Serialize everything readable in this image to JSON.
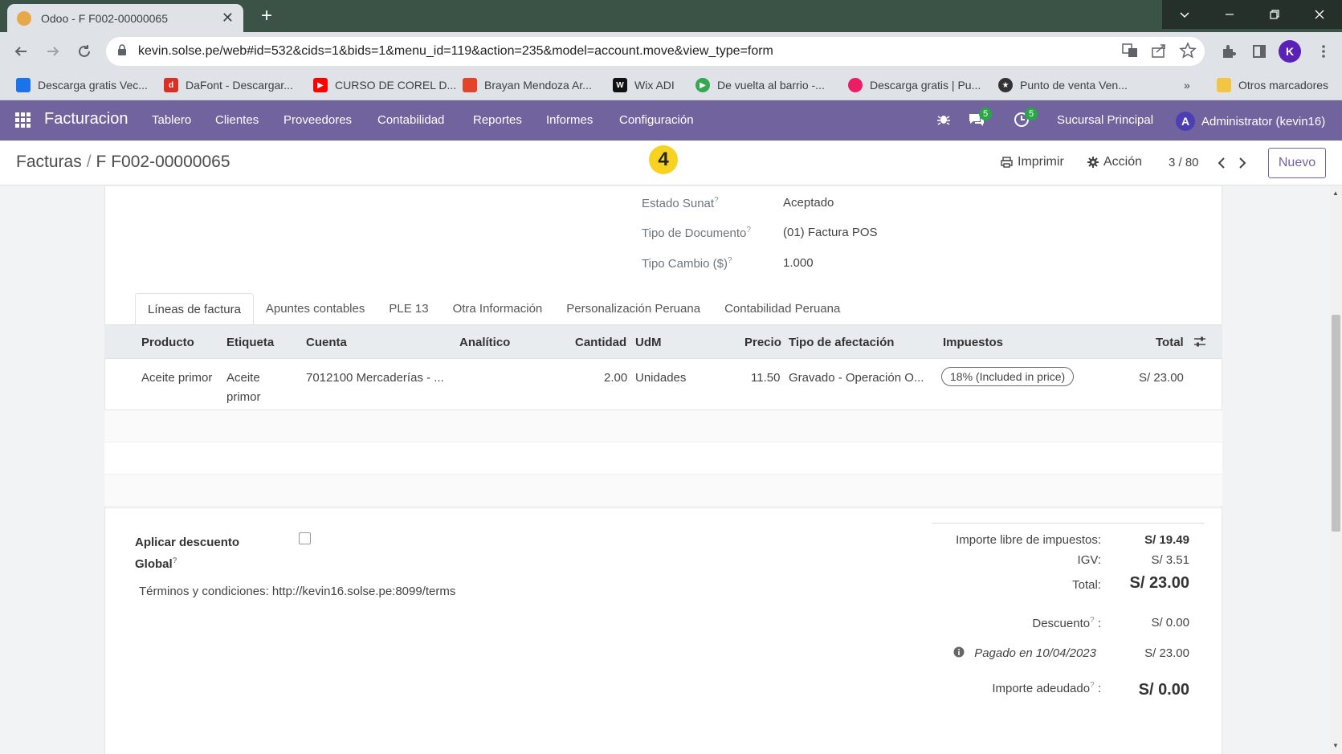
{
  "browser": {
    "tab_title": "Odoo - F F002-00000065",
    "url": "kevin.solse.pe/web#id=532&cids=1&bids=1&menu_id=119&action=235&model=account.move&view_type=form",
    "profile_initial": "K",
    "bookmarks": [
      {
        "label": "Descarga gratis Vec...",
        "color": "#1a73e8"
      },
      {
        "label": "DaFont - Descargar...",
        "color": "#d93025"
      },
      {
        "label": "CURSO DE COREL D...",
        "color": "#ff0000"
      },
      {
        "label": "Brayan Mendoza Ar...",
        "color": "#e24329"
      },
      {
        "label": "Wix ADI",
        "color": "#111111"
      },
      {
        "label": "De vuelta al barrio -...",
        "color": "#34a853"
      },
      {
        "label": "Descarga gratis | Pu...",
        "color": "#e91e63"
      },
      {
        "label": "Punto de venta Ven...",
        "color": "#333333"
      }
    ],
    "other_bookmarks": "Otros marcadores"
  },
  "navbar": {
    "brand": "Facturacion",
    "menu": [
      "Tablero",
      "Clientes",
      "Proveedores",
      "Contabilidad",
      "Reportes",
      "Informes",
      "Configuración"
    ],
    "messages_count": "5",
    "activities_count": "5",
    "company": "Sucursal Principal",
    "user_initial": "A",
    "user": "Administrator (kevin16)"
  },
  "control_panel": {
    "breadcrumb_parent": "Facturas",
    "breadcrumb_current": "F F002-00000065",
    "step_marker": "4",
    "print_label": "Imprimir",
    "action_label": "Acción",
    "pager": "3 / 80",
    "new_label": "Nuevo"
  },
  "fields": {
    "estado_sunat": {
      "label": "Estado Sunat",
      "value": "Aceptado"
    },
    "tipo_documento": {
      "label": "Tipo de Documento",
      "value": "(01) Factura POS"
    },
    "tipo_cambio": {
      "label": "Tipo Cambio ($)",
      "value": "1.000"
    }
  },
  "tabs": [
    "Líneas de factura",
    "Apuntes contables",
    "PLE 13",
    "Otra Información",
    "Personalización Peruana",
    "Contabilidad Peruana"
  ],
  "table": {
    "columns": {
      "producto": "Producto",
      "etiqueta": "Etiqueta",
      "cuenta": "Cuenta",
      "analitico": "Analítico",
      "cantidad": "Cantidad",
      "udm": "UdM",
      "precio": "Precio",
      "tipo_afectacion": "Tipo de afectación",
      "impuestos": "Impuestos",
      "total": "Total"
    },
    "rows": [
      {
        "producto": "Aceite primor",
        "etiqueta_1": "Aceite",
        "etiqueta_2": "primor",
        "cuenta": "7012100 Mercaderías - ...",
        "cantidad": "2.00",
        "udm": "Unidades",
        "precio": "11.50",
        "tipo_afectacion": "Gravado - Operación O...",
        "impuestos": "18% (Included in price)",
        "total": "S/ 23.00"
      }
    ]
  },
  "footer": {
    "discount_label_1": "Aplicar descuento",
    "discount_label_2": "Global",
    "terms": "Términos y condiciones: http://kevin16.solse.pe:8099/terms",
    "totals": {
      "untaxed_label": "Importe libre de impuestos:",
      "untaxed_value": "S/ 19.49",
      "igv_label": "IGV:",
      "igv_value": "S/ 3.51",
      "total_label": "Total:",
      "total_value": "S/ 23.00",
      "discount_label": "Descuento",
      "discount_value": "S/ 0.00",
      "paid_label": "Pagado en 10/04/2023",
      "paid_value": "S/ 23.00",
      "due_label": "Importe adeudado",
      "due_value": "S/ 0.00"
    }
  }
}
